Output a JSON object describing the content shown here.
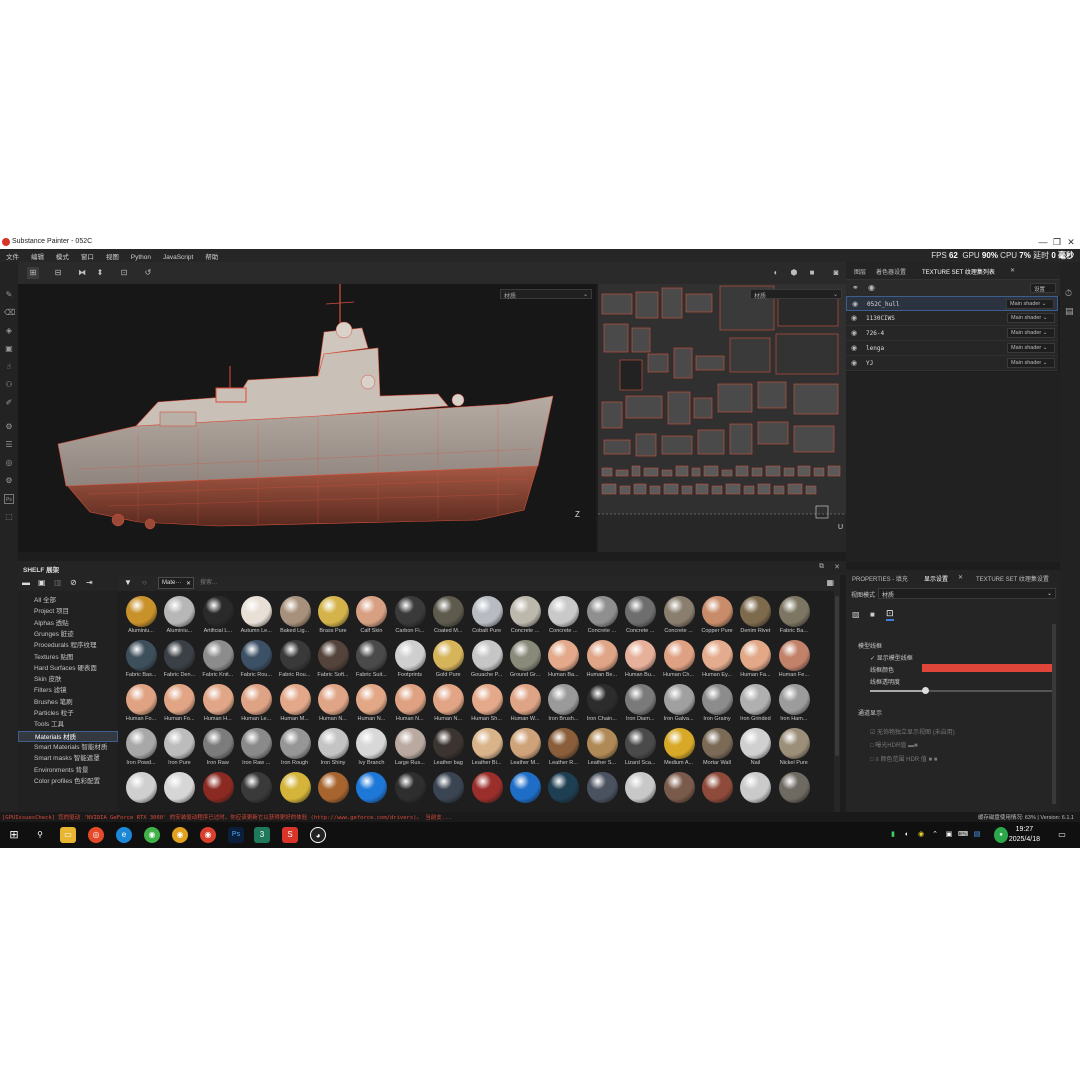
{
  "window": {
    "title": "Substance Painter - 052C",
    "minimize": "—",
    "maximize": "❐",
    "close": "✕"
  },
  "menu": [
    "文件",
    "编辑",
    "模式",
    "窗口",
    "视图",
    "Python",
    "JavaScript",
    "帮助"
  ],
  "stats": {
    "fps_label": "FPS",
    "fps": "62",
    "gpu_label": "GPU",
    "gpu": "90%",
    "cpu_label": "CPU",
    "cpu": "7%",
    "latency_label": "延时",
    "latency": "0 毫秒"
  },
  "viewport": {
    "left_dropdown": "材质",
    "right_dropdown": "材质",
    "axis_3d": "Z",
    "axis_2d": "U"
  },
  "right_panel": {
    "tabs": [
      "图层",
      "着色器设置",
      "TEXTURE SET 纹理集列表"
    ],
    "settings_button": "设置",
    "texture_sets": [
      {
        "name": "052C_hull",
        "shader": "Main shader"
      },
      {
        "name": "1130CIWS",
        "shader": "Main shader"
      },
      {
        "name": "726-4",
        "shader": "Main shader"
      },
      {
        "name": "lenga",
        "shader": "Main shader"
      },
      {
        "name": "YJ",
        "shader": "Main shader"
      }
    ]
  },
  "shelf": {
    "title": "SHELF 展架",
    "filter_tag": "Mate···",
    "search_placeholder": "搜索...",
    "categories": [
      "All 全部",
      "Project 项目",
      "Alphas 透贴",
      "Grunges 脏迹",
      "Procedurals 程序纹理",
      "Textures 贴图",
      "Hard Surfaces 硬表面",
      "Skin 皮肤",
      "Filters 滤镜",
      "Brushes 笔刷",
      "Particles 粒子",
      "Tools 工具",
      "Materials 材质",
      "Smart Materials 智能材质",
      "Smart masks 智能遮罩",
      "Environments 背景",
      "Color profiles 色彩配置"
    ],
    "selected_category": "Materials 材质",
    "materials": [
      {
        "name": "Aluminiu...",
        "color": "#c8912a"
      },
      {
        "name": "Aluminiu...",
        "color": "#b7b7b7"
      },
      {
        "name": "Artificial L...",
        "color": "#2a2a2a"
      },
      {
        "name": "Autumn Le...",
        "color": "#e8e0d6"
      },
      {
        "name": "Baked Lig...",
        "color": "#a8917c"
      },
      {
        "name": "Brass Pure",
        "color": "#d4b44a"
      },
      {
        "name": "Calf Skin",
        "color": "#d7a083"
      },
      {
        "name": "Carbon Fi...",
        "color": "#3a3a3a"
      },
      {
        "name": "Coated M...",
        "color": "#5e5a4d"
      },
      {
        "name": "Cobalt Pure",
        "color": "#b8bcc2"
      },
      {
        "name": "Concrete ...",
        "color": "#bdb8ac"
      },
      {
        "name": "Concrete ...",
        "color": "#c9c9c9"
      },
      {
        "name": "Concrete ...",
        "color": "#8f8f8f"
      },
      {
        "name": "Concrete ...",
        "color": "#6e6e6e"
      },
      {
        "name": "Concrete ...",
        "color": "#8a7e6e"
      },
      {
        "name": "Copper Pure",
        "color": "#c98c6a"
      },
      {
        "name": "Denim Rivet",
        "color": "#7e6a4d"
      },
      {
        "name": "Fabric Ba...",
        "color": "#7d7662"
      },
      {
        "name": "Fabric Bas...",
        "color": "#3e4f5c"
      },
      {
        "name": "Fabric Den...",
        "color": "#3b4046"
      },
      {
        "name": "Fabric Knit...",
        "color": "#8c8c8c"
      },
      {
        "name": "Fabric Rou...",
        "color": "#3c5066"
      },
      {
        "name": "Fabric Rou...",
        "color": "#393939"
      },
      {
        "name": "Fabric Soft...",
        "color": "#54433a"
      },
      {
        "name": "Fabric Suit...",
        "color": "#4a4a4a"
      },
      {
        "name": "Footprints",
        "color": "#cfcfcf"
      },
      {
        "name": "Gold Pure",
        "color": "#d6b45a"
      },
      {
        "name": "Gouache P...",
        "color": "#c6c6c6"
      },
      {
        "name": "Ground Gr...",
        "color": "#8a8a7a"
      },
      {
        "name": "Human Ba...",
        "color": "#e3a98a"
      },
      {
        "name": "Human Be...",
        "color": "#e0a487"
      },
      {
        "name": "Human Bu...",
        "color": "#e6b09a"
      },
      {
        "name": "Human Ch...",
        "color": "#dea184"
      },
      {
        "name": "Human Ey...",
        "color": "#e4ac8e"
      },
      {
        "name": "Human Fa...",
        "color": "#e2a888"
      },
      {
        "name": "Human Fe...",
        "color": "#c2826a"
      },
      {
        "name": "Human Fo...",
        "color": "#dfa383"
      },
      {
        "name": "Human Fo...",
        "color": "#e1a586"
      },
      {
        "name": "Human H...",
        "color": "#e0a687"
      },
      {
        "name": "Human Le...",
        "color": "#dea385"
      },
      {
        "name": "Human M...",
        "color": "#e3a889"
      },
      {
        "name": "Human N...",
        "color": "#e0a486"
      },
      {
        "name": "Human N...",
        "color": "#e2a787"
      },
      {
        "name": "Human N...",
        "color": "#dea283"
      },
      {
        "name": "Human N...",
        "color": "#e1a585"
      },
      {
        "name": "Human Sh...",
        "color": "#e3a98a"
      },
      {
        "name": "Human W...",
        "color": "#dfa485"
      },
      {
        "name": "Iron Brush...",
        "color": "#9a9a9a"
      },
      {
        "name": "Iron Chain...",
        "color": "#2c2c2c"
      },
      {
        "name": "Iron Diam...",
        "color": "#7a7a7a"
      },
      {
        "name": "Iron Galva...",
        "color": "#a0a0a0"
      },
      {
        "name": "Iron Grainy",
        "color": "#8c8c8c"
      },
      {
        "name": "Iron Grinded",
        "color": "#b0b0b0"
      },
      {
        "name": "Iron Ham...",
        "color": "#9c9c9c"
      },
      {
        "name": "Iron Powd...",
        "color": "#a8a8a8"
      },
      {
        "name": "Iron Pure",
        "color": "#bcbcbc"
      },
      {
        "name": "Iron Raw",
        "color": "#7c7c7c"
      },
      {
        "name": "Iron Raw ...",
        "color": "#8a8a8a"
      },
      {
        "name": "Iron Rough",
        "color": "#969696"
      },
      {
        "name": "Iron Shiny",
        "color": "#c4c4c4"
      },
      {
        "name": "Ivy Branch",
        "color": "#d8d8d8"
      },
      {
        "name": "Large Rus...",
        "color": "#b9a9a0"
      },
      {
        "name": "Leather bag",
        "color": "#3b3430"
      },
      {
        "name": "Leather Bi...",
        "color": "#d9b48a"
      },
      {
        "name": "Leather M...",
        "color": "#cfa37a"
      },
      {
        "name": "Leather R...",
        "color": "#8a5e3a"
      },
      {
        "name": "Leather S...",
        "color": "#b08a56"
      },
      {
        "name": "Lizard Sca...",
        "color": "#4a4a4a"
      },
      {
        "name": "Medium A...",
        "color": "#d8a928"
      },
      {
        "name": "Mortar Wall",
        "color": "#7a6a56"
      },
      {
        "name": "Nail",
        "color": "#d0d0d0"
      },
      {
        "name": "Nickel Pure",
        "color": "#9c8f7a"
      },
      {
        "name": "",
        "color": "#cfcfcf"
      },
      {
        "name": "",
        "color": "#d6d6d6"
      },
      {
        "name": "",
        "color": "#8a2a22"
      },
      {
        "name": "",
        "color": "#3a3a3a"
      },
      {
        "name": "",
        "color": "#d4b43a"
      },
      {
        "name": "",
        "color": "#a8642e"
      },
      {
        "name": "",
        "color": "#1e78d8"
      },
      {
        "name": "",
        "color": "#2e2e2e"
      },
      {
        "name": "",
        "color": "#3a4452"
      },
      {
        "name": "",
        "color": "#9a2e2a"
      },
      {
        "name": "",
        "color": "#1e6ec8"
      },
      {
        "name": "",
        "color": "#1e3e52"
      },
      {
        "name": "",
        "color": "#4a5260"
      },
      {
        "name": "",
        "color": "#c8c8c8"
      },
      {
        "name": "",
        "color": "#7a5a4a"
      },
      {
        "name": "",
        "color": "#8e4a3a"
      },
      {
        "name": "",
        "color": "#cacaca"
      },
      {
        "name": "",
        "color": "#6e6a62"
      }
    ]
  },
  "properties": {
    "tabs": [
      "PROPERTIES - 填充",
      "显示设置",
      "TEXTURE SET 纹理集设置"
    ],
    "view_mode_label": "视图模式",
    "view_mode_value": "材质",
    "section_wireframe": "模型线框",
    "show_wireframe": "显示模型线框",
    "wireframe_color_label": "线框颜色",
    "wireframe_color": "#e0453a",
    "wireframe_opacity_label": "线框透明度",
    "wireframe_opacity": 0.3,
    "section_overlay": "通道显示",
    "overlay_option": "无饰物独立显示视图 (未启用)",
    "exposure_label": "曝光HDR值",
    "color_range_label": "颜色范围 HDR 值"
  },
  "statusbar": {
    "message": "[GPUIssuesCheck] 您的驱动 'NVIDIA GeForce RTX 3060' 的安装驱动程序已过时。你应该更新它以获得更好的体验 (http://www.geforce.com/drivers)。 当前支...",
    "right": "缓存磁盘使用情况: 63% | Version: 6.1.1"
  },
  "taskbar": {
    "time": "19:27",
    "date": "2025/4/18"
  }
}
